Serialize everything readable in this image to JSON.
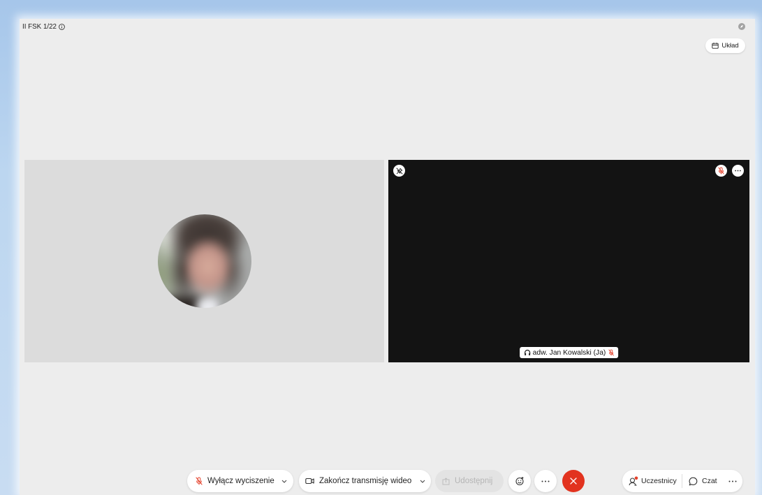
{
  "meeting": {
    "title": "II FSK 1/22",
    "info_icon": "info-icon",
    "status_icon": "connection-status-icon"
  },
  "layout_button": {
    "label": "Układ",
    "icon": "layout-icon"
  },
  "self_view": {
    "name": "adw. Jan Kowalski (Ja)",
    "audio_icon": "headphones-icon",
    "muted": true,
    "unpin_icon": "unpin-icon",
    "mute_icon": "mic-muted-icon",
    "more_icon": "more-icon"
  },
  "toolbar": {
    "unmute": {
      "label": "Wyłącz wyciszenie",
      "icon": "mic-muted-icon",
      "dropdown_icon": "chevron-down-icon"
    },
    "video": {
      "label": "Zakończ transmisję wideo",
      "icon": "camera-icon",
      "dropdown_icon": "chevron-down-icon"
    },
    "share": {
      "label": "Udostępnij",
      "icon": "share-icon",
      "disabled": true
    },
    "reactions": {
      "icon": "smiley-icon"
    },
    "more": {
      "icon": "more-icon"
    },
    "leave": {
      "icon": "close-icon"
    }
  },
  "side_controls": {
    "participants": {
      "label": "Uczestnicy",
      "icon": "participants-icon",
      "has_notification": true
    },
    "chat": {
      "label": "Czat",
      "icon": "chat-icon"
    },
    "more": {
      "icon": "more-icon"
    }
  },
  "colors": {
    "frame_blue": "#bcd6f0",
    "panel_bg": "#ededed",
    "remote_tile_bg": "#dcdcdc",
    "self_tile_bg": "#131313",
    "control_bg": "#ffffff",
    "muted_red": "#e4412b",
    "end_call_red": "#e2331f",
    "disabled_bg": "#e3e3e3",
    "disabled_text": "#b5b5b5",
    "text": "#1f1f1f"
  }
}
